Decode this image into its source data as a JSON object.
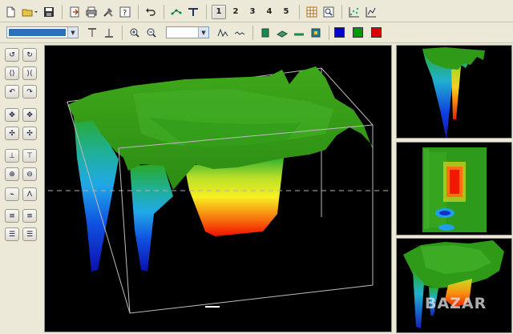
{
  "toolbar1": {
    "view_numbers": [
      "1",
      "2",
      "3",
      "4",
      "5"
    ],
    "active_view": "1"
  },
  "toolbar2": {
    "color_swatches": [
      "#0000cc",
      "#009900",
      "#dd0000"
    ],
    "combo_accent": "#2f6fb8"
  },
  "views": {
    "main": "3d-surface",
    "side_top": "side-profile",
    "side_middle": "top-heatmap",
    "side_bottom": "perspective-3d"
  },
  "watermark": {
    "text": "BAZAR"
  },
  "colors": {
    "background": "#000000",
    "chrome": "#ece9d8",
    "surface_high": "#3a9a18",
    "surface_deep": "#1020c8",
    "anomaly": "#ff2000"
  }
}
